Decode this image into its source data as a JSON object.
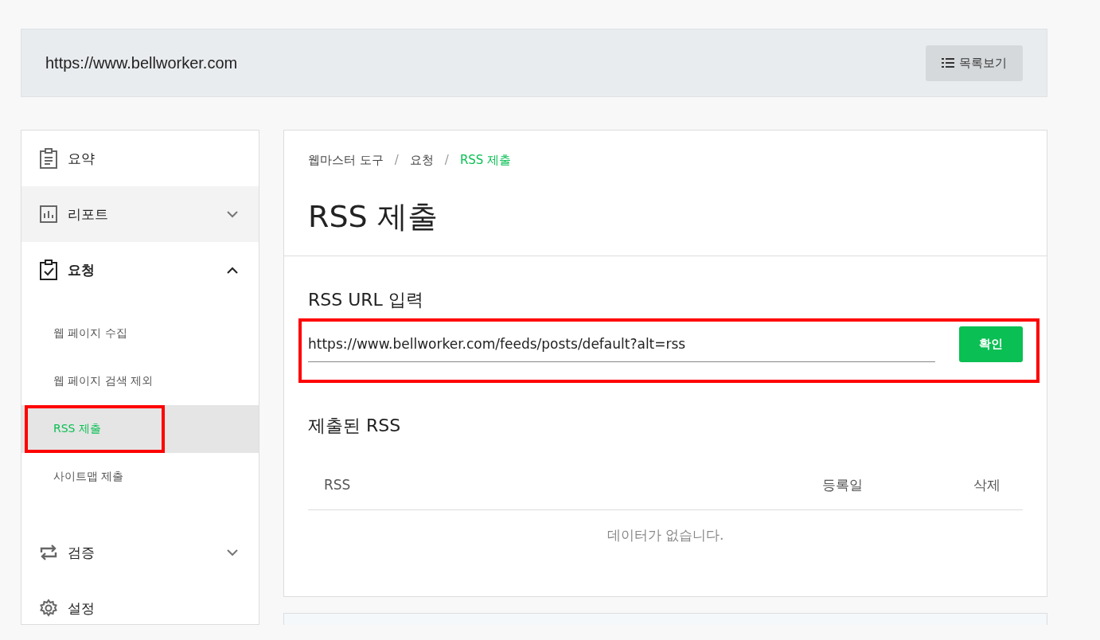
{
  "top_bar": {
    "site_url": "https://www.bellworker.com",
    "list_button": "목록보기"
  },
  "sidebar": {
    "items": [
      {
        "label": "요약",
        "kind": "link",
        "hovered": false
      },
      {
        "label": "리포트",
        "kind": "group",
        "expanded": false,
        "hovered": true
      },
      {
        "label": "요청",
        "kind": "group",
        "expanded": true,
        "hovered": false,
        "children": [
          {
            "label": "웹 페이지 수집",
            "selected": false,
            "highlighted": false
          },
          {
            "label": "웹 페이지 검색 제외",
            "selected": false,
            "highlighted": false
          },
          {
            "label": "RSS 제출",
            "selected": true,
            "highlighted": true
          },
          {
            "label": "사이트맵 제출",
            "selected": false,
            "highlighted": false
          }
        ]
      },
      {
        "label": "검증",
        "kind": "group",
        "expanded": false,
        "hovered": false
      },
      {
        "label": "설정",
        "kind": "link",
        "hovered": false
      }
    ]
  },
  "breadcrumb": [
    "웹마스터 도구",
    "요청",
    "RSS 제출"
  ],
  "breadcrumb_separator": "/",
  "page_title": "RSS 제출",
  "rss_input": {
    "label": "RSS URL 입력",
    "value": "https://www.bellworker.com/feeds/posts/default?alt=rss",
    "button": "확인",
    "highlighted": true
  },
  "submitted": {
    "title": "제출된 RSS",
    "columns": [
      "RSS",
      "등록일",
      "삭제"
    ],
    "empty_message": "데이터가 없습니다."
  }
}
